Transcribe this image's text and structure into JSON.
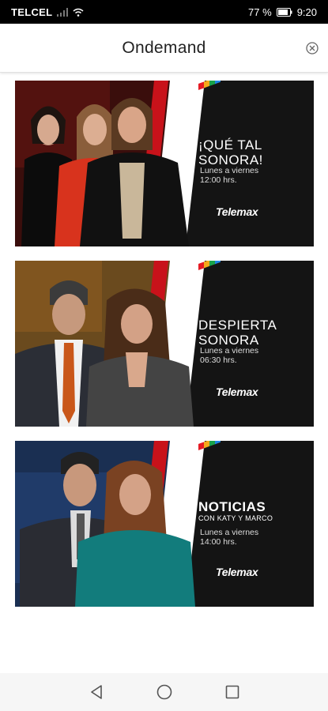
{
  "status_bar": {
    "carrier": "TELCEL",
    "battery_percent": "77 %",
    "time": "9:20"
  },
  "header": {
    "title": "Ondemand"
  },
  "shows": [
    {
      "title_line1": "¡QUÉ TAL",
      "title_line2": "SONORA!",
      "subtitle": "",
      "schedule_line1": "Lunes a viernes",
      "schedule_line2": "12:00 hrs.",
      "brand": "Telemax"
    },
    {
      "title_line1": "DESPIERTA",
      "title_line2": "SONORA",
      "subtitle": "",
      "schedule_line1": "Lunes a viernes",
      "schedule_line2": "06:30 hrs.",
      "brand": "Telemax"
    },
    {
      "title_line1": "NOTICIAS",
      "title_line2": "",
      "subtitle": "CON KATY Y MARCO",
      "schedule_line1": "Lunes a viernes",
      "schedule_line2": "14:00 hrs.",
      "brand": "Telemax"
    }
  ],
  "colors": {
    "accent_red": "#d32027",
    "dark_bg": "#151515",
    "white_stripe": "#ffffff"
  }
}
